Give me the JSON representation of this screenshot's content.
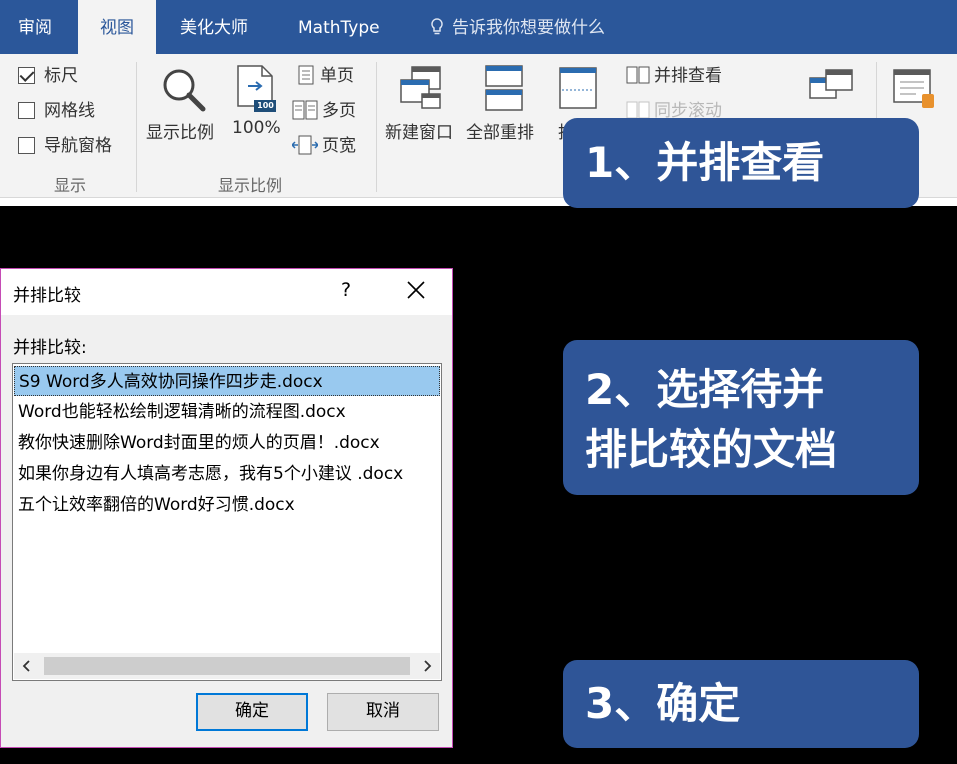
{
  "ribbon": {
    "tabs": [
      {
        "label": "审阅",
        "active": false
      },
      {
        "label": "视图",
        "active": true
      },
      {
        "label": "美化大师",
        "active": false
      },
      {
        "label": "MathType",
        "active": false
      }
    ],
    "tell_me": "告诉我你想要做什么",
    "show_group": {
      "label": "显示",
      "items": [
        {
          "label": "标尺",
          "checked": true
        },
        {
          "label": "网格线",
          "checked": false
        },
        {
          "label": "导航窗格",
          "checked": false
        }
      ]
    },
    "zoom_group": {
      "label": "显示比例",
      "zoom_button": "显示比例",
      "hundred_button": "100%",
      "hundred_badge": "100",
      "one_page": "单页",
      "multi_page": "多页",
      "page_width": "页宽"
    },
    "window_group": {
      "new_window": "新建窗口",
      "arrange_all": "全部重排",
      "split_partial": "拆",
      "side_by_side": "并排查看",
      "sync_scroll": "同步滚动"
    }
  },
  "callouts": {
    "step1": "1、并排查看",
    "step2_line1": "2、选择待并",
    "step2_line2": "排比较的文档",
    "step3": "3、确定"
  },
  "dialog": {
    "title": "并排比较",
    "help": "?",
    "prompt": "并排比较:",
    "files": [
      "S9 Word多人高效协同操作四步走.docx",
      "Word也能轻松绘制逻辑清晰的流程图.docx",
      "教你快速删除Word封面里的烦人的页眉！.docx",
      "如果你身边有人填高考志愿，我有5个小建议 .docx",
      "五个让效率翻倍的Word好习惯.docx"
    ],
    "selected_index": 0,
    "ok": "确定",
    "cancel": "取消"
  },
  "colors": {
    "ribbon_blue": "#2b579a",
    "callout_blue": "#2f5597",
    "selection": "#99c9ef"
  }
}
